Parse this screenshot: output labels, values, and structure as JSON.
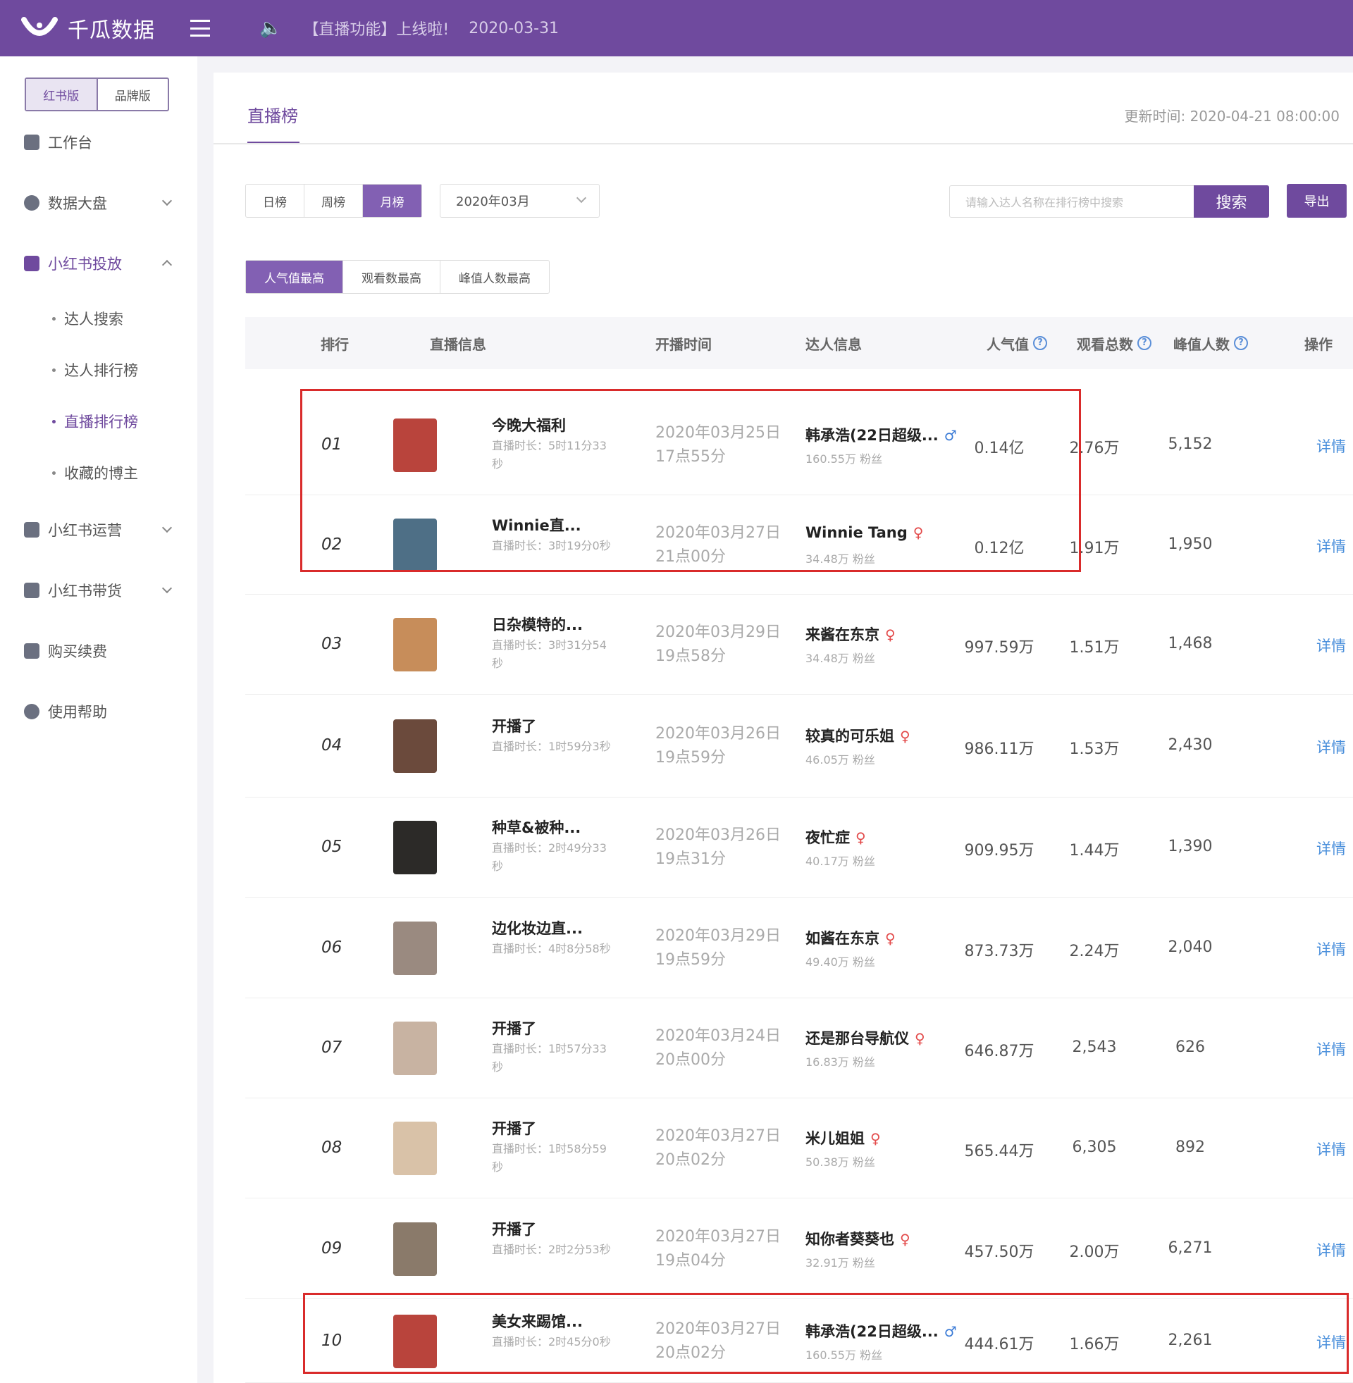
{
  "topbar": {
    "brand": "千瓜数据",
    "notice": "【直播功能】上线啦!",
    "notice_date": "2020-03-31"
  },
  "sidebar": {
    "editions": [
      "红书版",
      "品牌版"
    ],
    "items": [
      {
        "label": "工作台"
      },
      {
        "label": "数据大盘"
      },
      {
        "label": "小红书投放"
      },
      {
        "label": "小红书运营"
      },
      {
        "label": "小红书带货"
      },
      {
        "label": "购买续费"
      },
      {
        "label": "使用帮助"
      }
    ],
    "subitems": [
      {
        "label": "达人搜索"
      },
      {
        "label": "达人排行榜"
      },
      {
        "label": "直播排行榜"
      },
      {
        "label": "收藏的博主"
      }
    ]
  },
  "main": {
    "tab": "直播榜",
    "updated": "更新时间:  2020-04-21 08:00:00",
    "period_tabs": [
      "日榜",
      "周榜",
      "月榜"
    ],
    "month": "2020年03月",
    "search_placeholder": "请输入达人名称在排行榜中搜索",
    "search_label": "搜索",
    "export_label": "导出",
    "sort_tabs": [
      "人气值最高",
      "观看数最高",
      "峰值人数最高"
    ],
    "columns": [
      "排行",
      "直播信息",
      "开播时间",
      "达人信息",
      "人气值",
      "观看总数",
      "峰值人数",
      "操作"
    ],
    "help_mark": "?",
    "detail_label": "详情"
  },
  "rows": [
    {
      "rank": "01",
      "title": "今晚大福利",
      "duration": "直播时长：5时11分33秒",
      "time1": "2020年03月25日",
      "time2": "17点55分",
      "name": "韩承浩(22日超级...",
      "gender": "♂",
      "gender_type": "m",
      "fans": "160.55万 粉丝",
      "pop": "0.14亿",
      "views": "2.76万",
      "peak": "5,152"
    },
    {
      "rank": "02",
      "title": "Winnie直...",
      "duration": "直播时长：3时19分0秒",
      "time1": "2020年03月27日",
      "time2": "21点00分",
      "name": "Winnie Tang",
      "gender": "♀",
      "gender_type": "f",
      "fans": "34.48万 粉丝",
      "pop": "0.12亿",
      "views": "1.91万",
      "peak": "1,950"
    },
    {
      "rank": "03",
      "title": "日杂模特的...",
      "duration": "直播时长：3时31分54秒",
      "time1": "2020年03月29日",
      "time2": "19点58分",
      "name": "来酱在东京",
      "gender": "♀",
      "gender_type": "f",
      "fans": "34.48万 粉丝",
      "pop": "997.59万",
      "views": "1.51万",
      "peak": "1,468"
    },
    {
      "rank": "04",
      "title": "开播了",
      "duration": "直播时长：1时59分3秒",
      "time1": "2020年03月26日",
      "time2": "19点59分",
      "name": "较真的可乐姐",
      "gender": "♀",
      "gender_type": "f",
      "fans": "46.05万 粉丝",
      "pop": "986.11万",
      "views": "1.53万",
      "peak": "2,430"
    },
    {
      "rank": "05",
      "title": "种草&被种...",
      "duration": "直播时长：2时49分33秒",
      "time1": "2020年03月26日",
      "time2": "19点31分",
      "name": "夜忙症",
      "gender": "♀",
      "gender_type": "f",
      "fans": "40.17万 粉丝",
      "pop": "909.95万",
      "views": "1.44万",
      "peak": "1,390"
    },
    {
      "rank": "06",
      "title": "边化妆边直...",
      "duration": "直播时长：4时8分58秒",
      "time1": "2020年03月29日",
      "time2": "19点59分",
      "name": "如酱在东京",
      "gender": "♀",
      "gender_type": "f",
      "fans": "49.40万 粉丝",
      "pop": "873.73万",
      "views": "2.24万",
      "peak": "2,040"
    },
    {
      "rank": "07",
      "title": "开播了",
      "duration": "直播时长：1时57分33秒",
      "time1": "2020年03月24日",
      "time2": "20点00分",
      "name": "还是那台导航仪",
      "gender": "♀",
      "gender_type": "f",
      "fans": "16.83万 粉丝",
      "pop": "646.87万",
      "views": "2,543",
      "peak": "626"
    },
    {
      "rank": "08",
      "title": "开播了",
      "duration": "直播时长：1时58分59秒",
      "time1": "2020年03月27日",
      "time2": "20点02分",
      "name": "米儿姐姐",
      "gender": "♀",
      "gender_type": "f",
      "fans": "50.38万 粉丝",
      "pop": "565.44万",
      "views": "6,305",
      "peak": "892"
    },
    {
      "rank": "09",
      "title": "开播了",
      "duration": "直播时长：2时2分53秒",
      "time1": "2020年03月27日",
      "time2": "19点04分",
      "name": "知你者葵葵也",
      "gender": "♀",
      "gender_type": "f",
      "fans": "32.91万 粉丝",
      "pop": "457.50万",
      "views": "2.00万",
      "peak": "6,271"
    },
    {
      "rank": "10",
      "title": "美女来踢馆...",
      "duration": "直播时长：2时45分0秒",
      "time1": "2020年03月27日",
      "time2": "20点02分",
      "name": "韩承浩(22日超级...",
      "gender": "♂",
      "gender_type": "m",
      "fans": "160.55万 粉丝",
      "pop": "444.61万",
      "views": "1.66万",
      "peak": "2,261"
    }
  ],
  "colors": {
    "brand": "#6f4a9e",
    "highlight": "#d92b2b",
    "link": "#4a8fdb"
  }
}
